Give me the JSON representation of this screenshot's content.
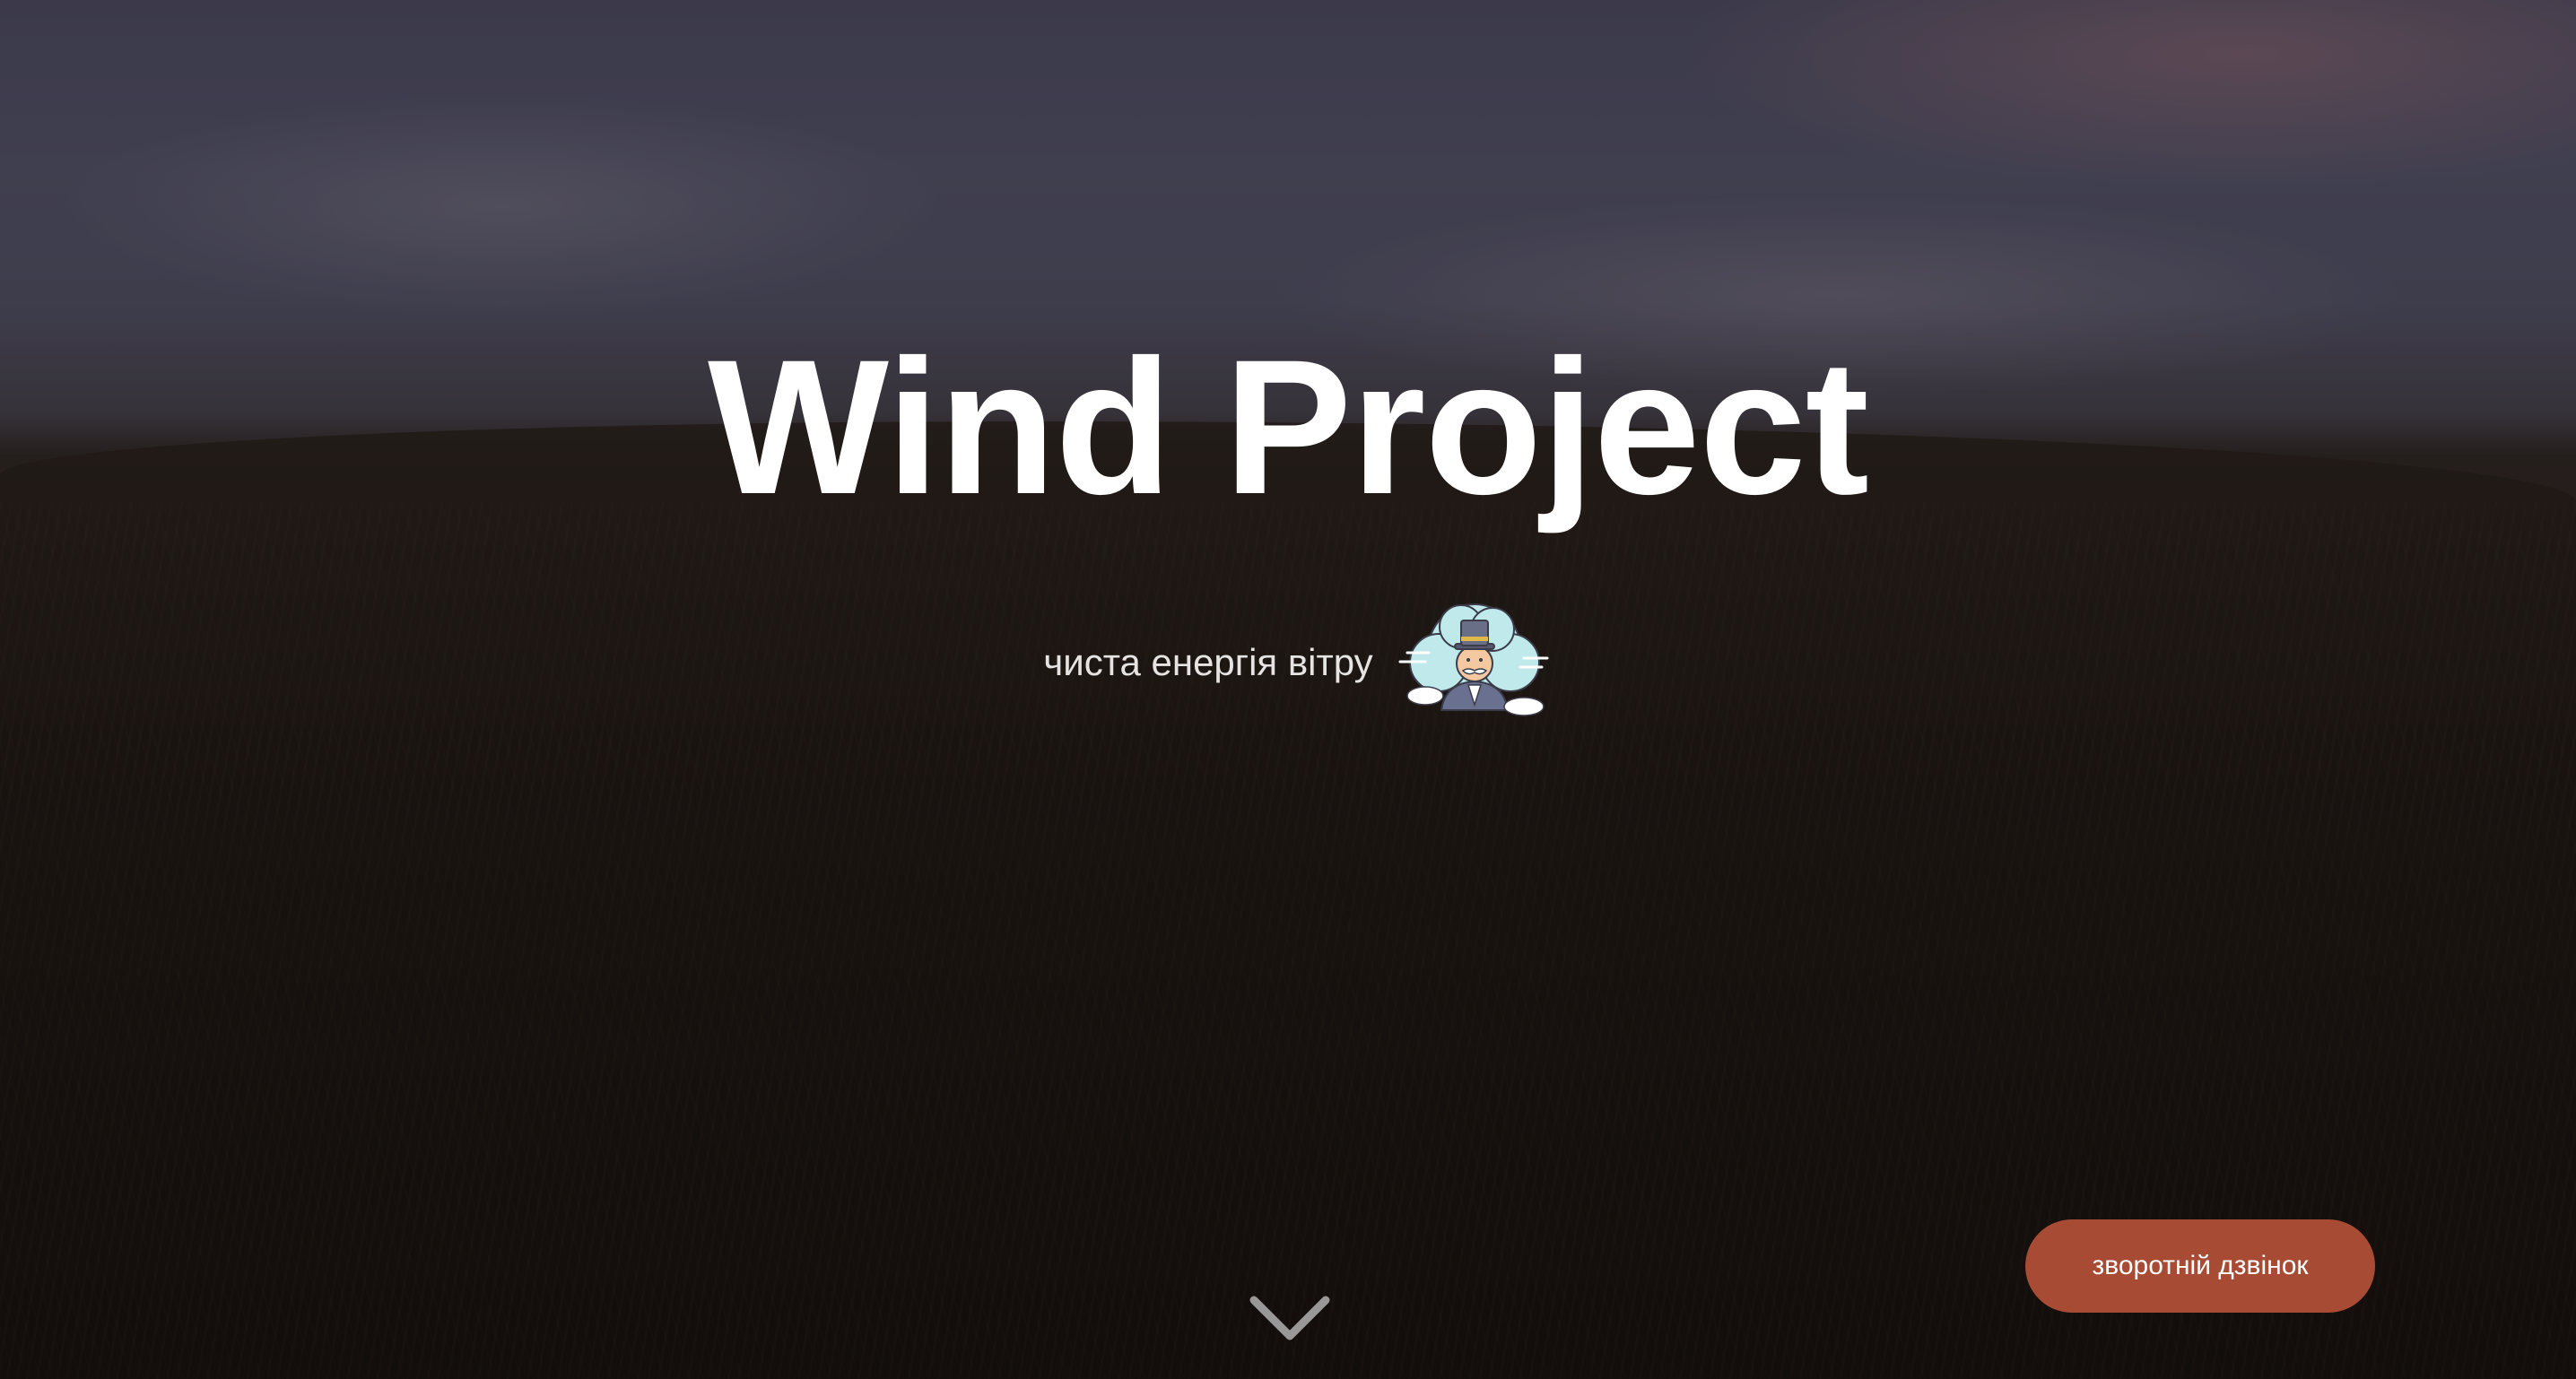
{
  "hero": {
    "title": "Wind Project",
    "subtitle": "чиста енергія вітру",
    "mascot_icon": "top-hat-gentleman-cloud-icon",
    "scroll_icon": "chevron-down-icon"
  },
  "callback": {
    "label": "зворотній дзвінок"
  },
  "colors": {
    "accent": "#a84b35",
    "title": "#ffffff",
    "subtitle": "#e6e3e3"
  }
}
